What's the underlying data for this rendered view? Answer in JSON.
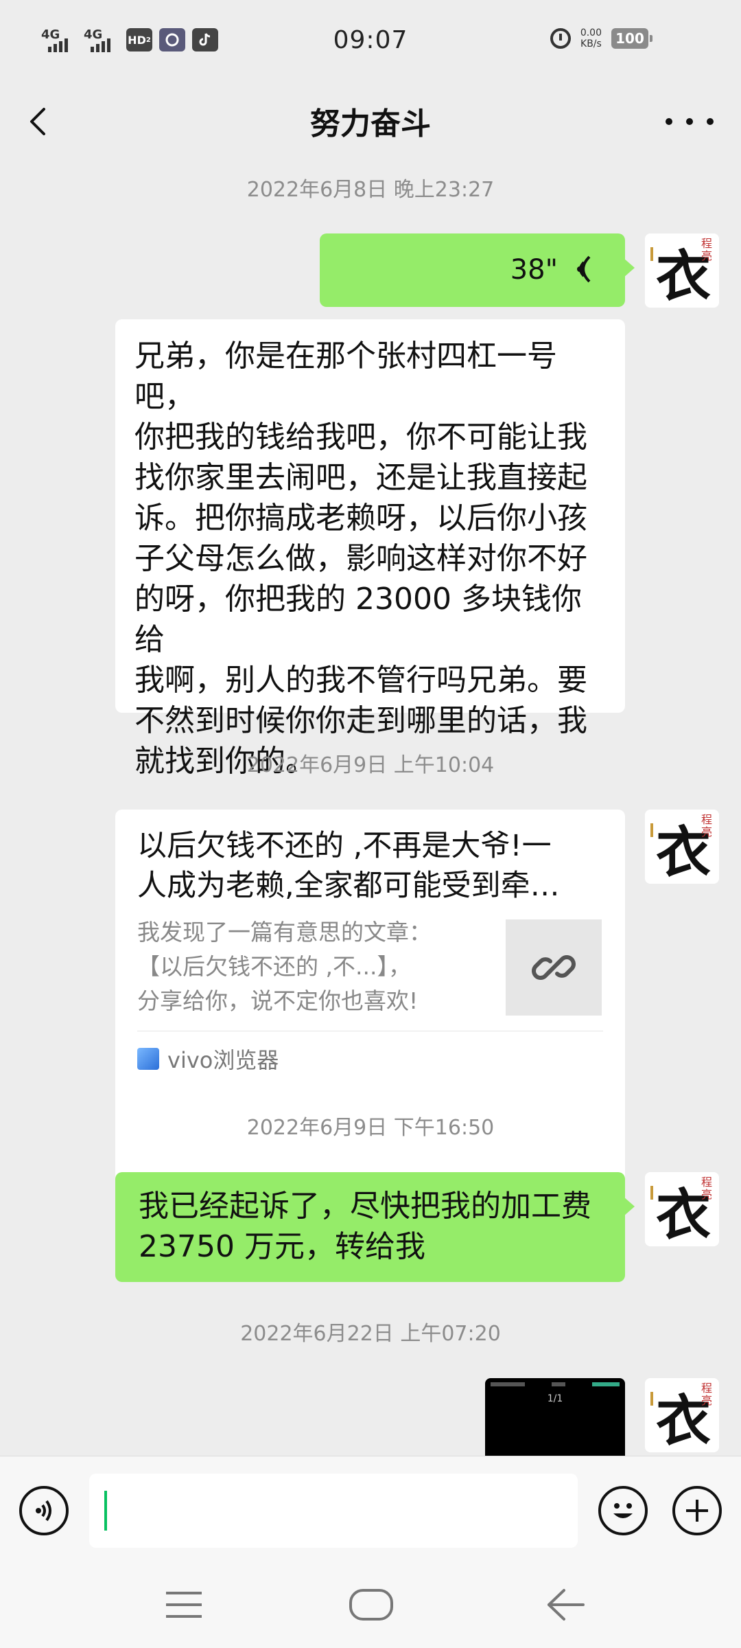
{
  "status_bar": {
    "network_1": "4G",
    "network_2": "4G",
    "hd_badge": "HD",
    "hd_sub": "2",
    "time": "09:07",
    "speed_value": "0.00",
    "speed_unit": "KB/s",
    "battery": "100"
  },
  "header": {
    "title": "努力奋斗"
  },
  "messages": [
    {
      "type": "timestamp",
      "text": "2022年6月8日 晚上23:27"
    },
    {
      "type": "voice",
      "side": "right",
      "duration": "38\""
    },
    {
      "type": "text",
      "side": "left",
      "lines": [
        "兄弟，你是在那个张村四杠一号吧，",
        "你把我的钱给我吧，你不可能让我",
        "找你家里去闹吧，还是让我直接起",
        "诉。把你搞成老赖呀，以后你小孩",
        "子父母怎么做，影响这样对你不好",
        "的呀，你把我的 23000 多块钱你给",
        "我啊，别人的我不管行吗兄弟。要",
        "不然到时候你你走到哪里的话，我",
        "就找到你的。"
      ]
    },
    {
      "type": "timestamp",
      "text": "2022年6月9日 上午10:04"
    },
    {
      "type": "link",
      "side": "right",
      "title_lines": [
        "以后欠钱不还的 ,不再是大爷!一",
        "人成为老赖,全家都可能受到牵…"
      ],
      "desc_lines": [
        "我发现了一篇有意思的文章：",
        "【以后欠钱不还的 ,不...】，",
        "分享给你，说不定你也喜欢!"
      ],
      "source": "vivo浏览器"
    },
    {
      "type": "timestamp",
      "text": "2022年6月9日 下午16:50"
    },
    {
      "type": "text",
      "side": "right",
      "lines": [
        "我已经起诉了，尽快把我的加工费",
        "23750 万元，转给我"
      ]
    },
    {
      "type": "timestamp",
      "text": "2022年6月22日 上午07:20"
    },
    {
      "type": "image",
      "side": "right",
      "caption": "1/1"
    }
  ],
  "avatar": {
    "char": "衣",
    "seal_top": "程",
    "seal_bottom": "亮"
  },
  "input": {
    "value": "",
    "placeholder": ""
  },
  "colors": {
    "background": "#ededed",
    "sent_bubble": "#95ec69",
    "received_bubble": "#ffffff",
    "caret": "#07c160"
  }
}
